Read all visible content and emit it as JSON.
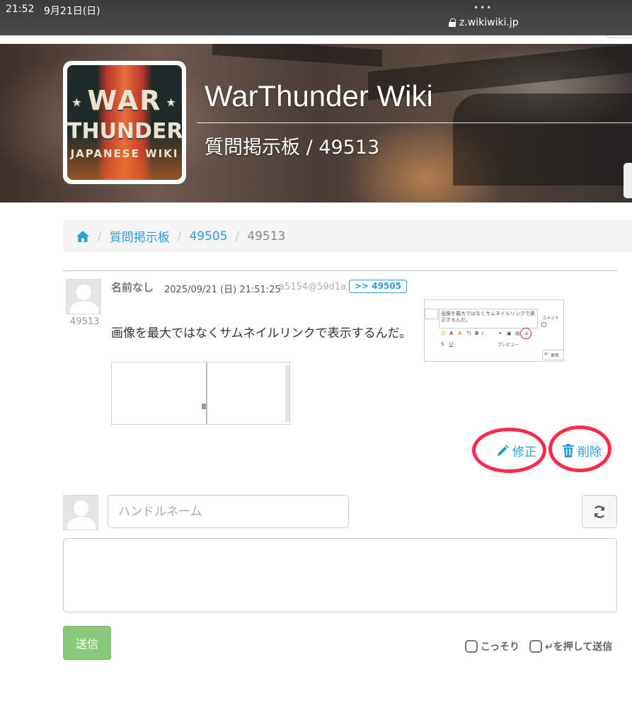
{
  "statusbar": {
    "time": "21:52",
    "date": "9月21日(日)",
    "dots": "•••",
    "url": "z.wikiwiki.jp"
  },
  "hero": {
    "logo_text_war": "WAR",
    "logo_text_thunder": "THUNDER",
    "logo_text_sub": "JAPANESE WIKI",
    "site_title": "WarThunder Wiki",
    "page_heading": "質問掲示板 / 49513"
  },
  "breadcrumb": {
    "items": [
      "質問掲示板",
      "49505"
    ],
    "current": "49513",
    "separator": "/"
  },
  "comment": {
    "number": "49513",
    "author": "名前なし",
    "datetime": "2025/09/21 (日) 21:51:25",
    "id": "a5154@59d1a",
    "reply_label": ">> 49505",
    "body": "画像を最大ではなくサムネイルリンクで表示するんだ。",
    "thumb_text": "画像を最大ではなくサムネイルリンクで表示するんだ。",
    "thumb_preview": "プレビュー",
    "thumb_side": "コメント",
    "thumb_reload": "更新",
    "edit_label": "修正",
    "delete_label": "削除"
  },
  "form": {
    "handle_placeholder": "ハンドルネーム",
    "send_label": "送信",
    "option_sneak": "こっそり",
    "option_enter_send": "↵を押して送信"
  },
  "colors": {
    "link": "#2a9fd6",
    "send_button": "#8bc97a",
    "annotation_circle": "#ff2a4a"
  }
}
